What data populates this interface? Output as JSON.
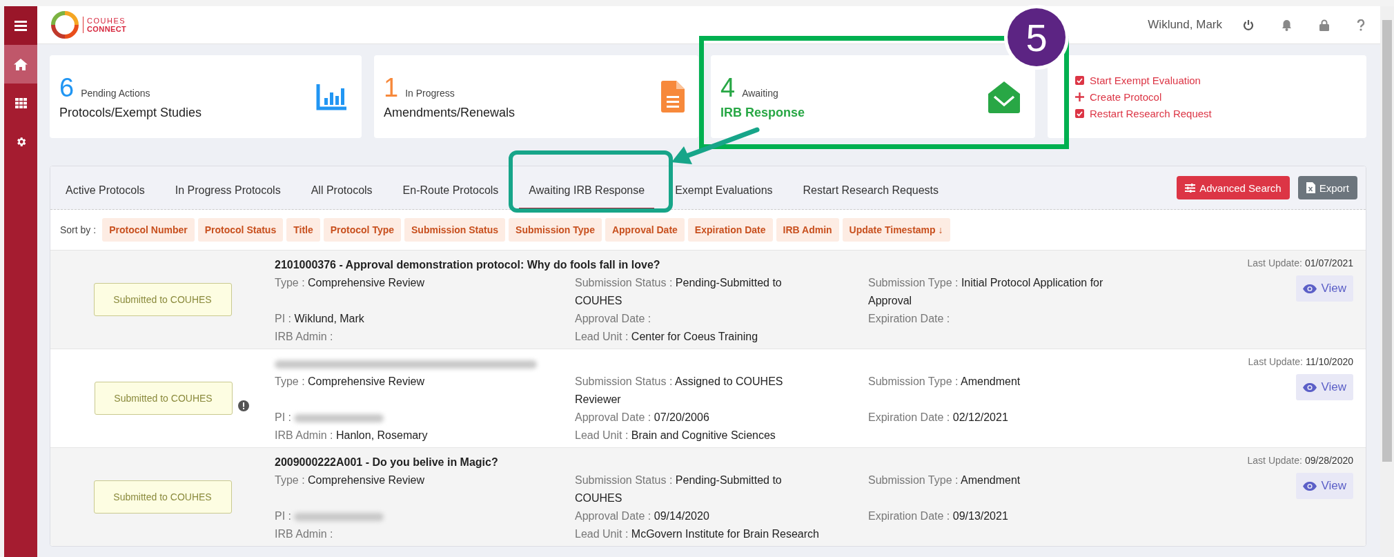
{
  "logo": {
    "line_1": "COUHES",
    "line_2": "CONNECT"
  },
  "header": {
    "user": "Wiklund, Mark"
  },
  "summary_cards": [
    {
      "count": "6",
      "caption": "Pending Actions",
      "title": "Protocols/Exempt Studies",
      "color": "#2196f3",
      "kind": "chart"
    },
    {
      "count": "1",
      "caption": "In Progress",
      "title": "Amendments/Renewals",
      "color": "#f7893b",
      "kind": "document"
    },
    {
      "count": "4",
      "caption": "Awaiting",
      "title": "IRB Response",
      "color": "#28a745",
      "kind": "envelope"
    }
  ],
  "quick_actions": [
    {
      "label": "Start Exempt Evaluation",
      "kind": "check"
    },
    {
      "label": "Create Protocol",
      "kind": "plus"
    },
    {
      "label": "Restart Research Request",
      "kind": "check"
    }
  ],
  "tabs": [
    {
      "label": "Active Protocols",
      "selected": false
    },
    {
      "label": "In Progress Protocols",
      "selected": false
    },
    {
      "label": "All Protocols",
      "selected": false
    },
    {
      "label": "En-Route Protocols",
      "selected": false
    },
    {
      "label": "Awaiting IRB Response",
      "selected": true
    },
    {
      "label": "Exempt Evaluations",
      "selected": false
    },
    {
      "label": "Restart Research Requests",
      "selected": false
    }
  ],
  "buttons": [
    {
      "label": "Advanced Search",
      "kind": "primary"
    },
    {
      "label": "Export",
      "kind": "secondary"
    }
  ],
  "sort": {
    "label": "Sort by :",
    "options": [
      "Protocol Number",
      "Protocol Status",
      "Title",
      "Protocol Type",
      "Submission Status",
      "Submission Type",
      "Approval Date",
      "Expiration Date",
      "IRB Admin",
      "Update Timestamp ↓"
    ]
  },
  "rows": [
    {
      "status": "Submitted to COUHES",
      "warning": false,
      "kind": "plain",
      "number": "2101000376",
      "title": "- Approval demonstration protocol: Why do fools fall in love?",
      "last_update_label": "Last Update:",
      "last_update": "01/07/2021",
      "view": "View",
      "fields": [
        {
          "label": "Type :",
          "value": "Comprehensive Review",
          "kind": "text"
        },
        {
          "label": "Submission Status :",
          "value": "Pending-Submitted to COUHES",
          "kind": "text"
        },
        {
          "label": "Submission Type :",
          "value": "Initial Protocol Application for Approval",
          "kind": "text"
        },
        {
          "label": "PI :",
          "value": "Wiklund, Mark",
          "kind": "text"
        },
        {
          "label": "Approval Date :",
          "kind": "text"
        },
        {
          "label": "Expiration Date :",
          "kind": "text"
        },
        {
          "label": "IRB Admin :",
          "kind": "text"
        },
        {
          "label": "Lead Unit :",
          "value": "Center for Coeus Training",
          "kind": "text"
        }
      ]
    },
    {
      "status": "Submitted to COUHES",
      "warning": true,
      "kind": "redacted",
      "last_update_label": "Last Update:",
      "last_update": "11/10/2020",
      "view": "View",
      "fields": [
        {
          "label": "Type :",
          "value": "Comprehensive Review",
          "kind": "text"
        },
        {
          "label": "Submission Status :",
          "value": "Assigned to COUHES Reviewer",
          "kind": "text"
        },
        {
          "label": "Submission Type :",
          "value": "Amendment",
          "kind": "text"
        },
        {
          "label": "PI :",
          "kind": "redacted"
        },
        {
          "label": "Approval Date :",
          "value": "07/20/2006",
          "kind": "text"
        },
        {
          "label": "Expiration Date :",
          "value": "02/12/2021",
          "kind": "text"
        },
        {
          "label": "IRB Admin :",
          "value": "Hanlon, Rosemary",
          "kind": "text"
        },
        {
          "label": "Lead Unit :",
          "value": "Brain and Cognitive Sciences",
          "kind": "text"
        }
      ]
    },
    {
      "status": "Submitted to COUHES",
      "warning": false,
      "kind": "plain",
      "number": "2009000222A001",
      "title": "- Do you belive in Magic?",
      "last_update_label": "Last Update:",
      "last_update": "09/28/2020",
      "view": "View",
      "fields": [
        {
          "label": "Type :",
          "value": "Comprehensive Review",
          "kind": "text"
        },
        {
          "label": "Submission Status :",
          "value": "Pending-Submitted to COUHES",
          "kind": "text"
        },
        {
          "label": "Submission Type :",
          "value": "Amendment",
          "kind": "text"
        },
        {
          "label": "PI :",
          "kind": "redacted"
        },
        {
          "label": "Approval Date :",
          "value": "09/14/2020",
          "kind": "text"
        },
        {
          "label": "Expiration Date :",
          "value": "09/13/2021",
          "kind": "text"
        },
        {
          "label": "IRB Admin :",
          "kind": "text"
        },
        {
          "label": "Lead Unit :",
          "value": "McGovern Institute for Brain Research",
          "kind": "text"
        }
      ]
    }
  ],
  "annotation": {
    "step": "5"
  }
}
